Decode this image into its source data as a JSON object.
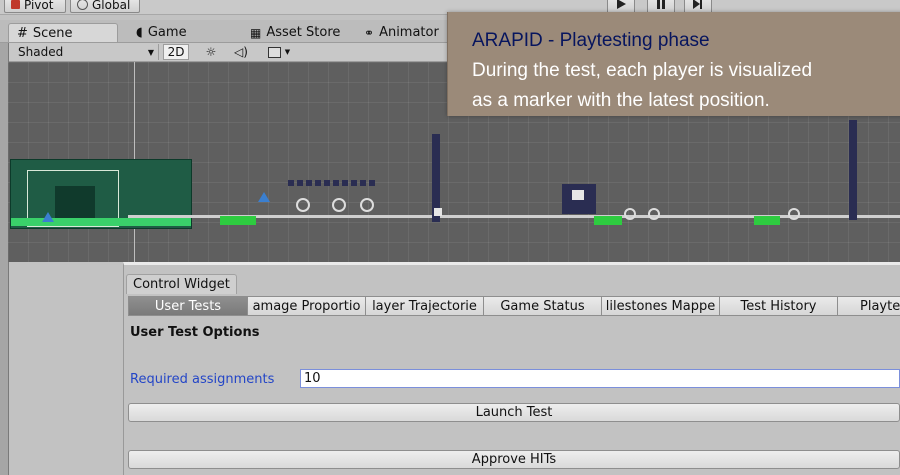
{
  "top_bar": {
    "pivot_label": "Pivot",
    "global_label": "Global"
  },
  "tabs": [
    {
      "label": "Scene",
      "icon": "grid-icon"
    },
    {
      "label": "Game",
      "icon": "pacman-icon"
    },
    {
      "label": "Asset Store",
      "icon": "store-icon"
    },
    {
      "label": "Animator",
      "icon": "animator-icon"
    }
  ],
  "scene_toolbar": {
    "shading_mode": "Shaded",
    "mode_2d": "2D"
  },
  "overlay": {
    "title": "ARAPID - Playtesting  phase",
    "line1": "During the test, each player is visualized",
    "line2": "as a marker with the latest position."
  },
  "control_widget": {
    "tab_label": "Control Widget",
    "tabs": [
      "User Tests",
      "amage Proportio",
      "layer Trajectorie",
      "Game Status",
      "lilestones Mappe",
      "Test History",
      "Playte"
    ],
    "active_tab": "User Tests",
    "section_title": "User Test Options",
    "required_assignments_label": "Required assignments",
    "required_assignments_value": "10",
    "launch_label": "Launch Test",
    "approve_label": "Approve HITs"
  },
  "colors": {
    "overlay_bg": "#9b8a79",
    "overlay_title": "#07155e",
    "label_blue": "#2446c7",
    "scene_bg": "#5f5f5f",
    "platform_green": "#2ecc40"
  }
}
